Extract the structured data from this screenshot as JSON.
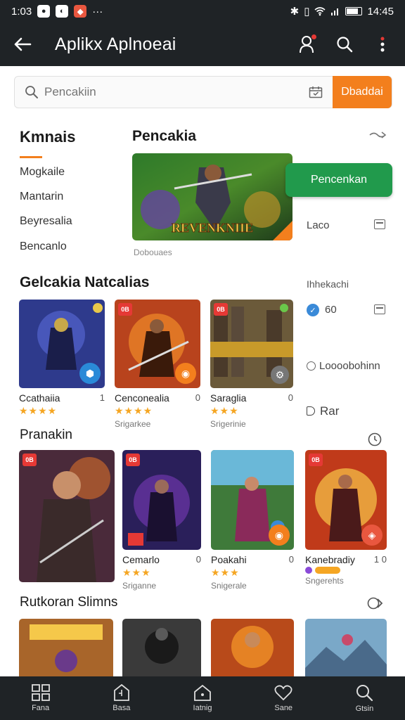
{
  "status": {
    "time": "1:03",
    "clock": "14:45",
    "apps": [
      "●",
      "●",
      "●"
    ],
    "more": "···"
  },
  "appbar": {
    "title": "Aplikx Aplnoeai"
  },
  "search": {
    "placeholder": "Pencakiin",
    "button_label": "Dbaddai"
  },
  "categories": {
    "title": "Kmnais",
    "items": [
      "Mogkaile",
      "Mantarin",
      "Beyresalia",
      "Bencanlo"
    ]
  },
  "featured": {
    "title": "Pencakia",
    "caption": "Dobouaes",
    "banner_text": "REVENKNIIE",
    "cta_label": "Pencenkan"
  },
  "side": {
    "laco": "Laco",
    "header": "Ihhekachi",
    "count": "60",
    "option1": "Loooobohinn",
    "option2": "Rar"
  },
  "section1": {
    "title": "Gelcakia Natcalias",
    "cards": [
      {
        "name": "Ccathaiia",
        "num": "1",
        "stars": "★★★★",
        "sub": "",
        "tag": "",
        "color": "#2e3a8c"
      },
      {
        "name": "Cenconealia",
        "num": "0",
        "stars": "★★★★",
        "sub": "Srigarkee",
        "tag": "0B",
        "color": "#b8431d"
      },
      {
        "name": "Saraglia",
        "num": "0",
        "stars": "★★★",
        "sub": "Srigerinie",
        "tag": "0B",
        "color": "#6b5a3a"
      }
    ]
  },
  "section2": {
    "title": "Pranakin",
    "cards": [
      {
        "name": "",
        "num": "",
        "stars": "",
        "sub": "",
        "tag": "0B",
        "color": "#4a2a3a"
      },
      {
        "name": "Cemarlo",
        "num": "0",
        "stars": "★★★",
        "sub": "Sriganne",
        "tag": "0B",
        "color": "#2a1f5a"
      },
      {
        "name": "Poakahi",
        "num": "0",
        "stars": "★★★",
        "sub": "Snigerale",
        "tag": "",
        "color": "#3f7a3a"
      },
      {
        "name": "Kanebradiy",
        "num": "1 0",
        "stars": "",
        "sub": "Sngerehts",
        "tag": "0B",
        "color": "#c03a1a"
      }
    ]
  },
  "section3": {
    "title": "Rutkoran Slimns",
    "cards": [
      {
        "color": "#a8652a"
      },
      {
        "color": "#3a3a3a"
      },
      {
        "color": "#b84a1a"
      },
      {
        "color": "#7aa8c8"
      }
    ]
  },
  "nav": [
    "Fana",
    "Basa",
    "Iatnig",
    "Sane",
    "Gtsin"
  ]
}
